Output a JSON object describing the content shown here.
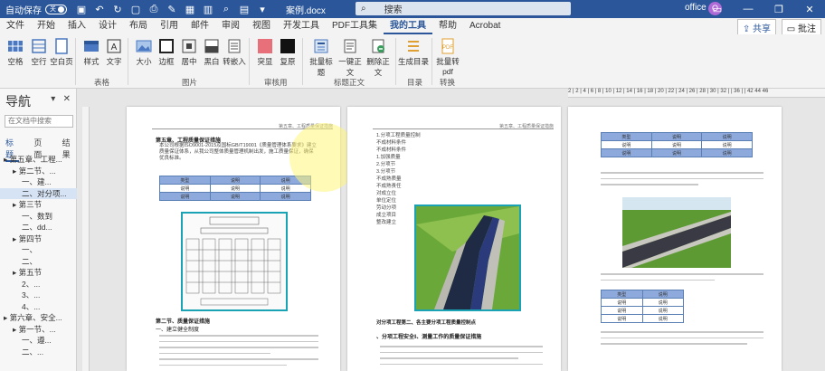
{
  "titlebar": {
    "autosave_label": "自动保存",
    "autosave_state": "关",
    "doc_title": "案例.docx",
    "search_placeholder": "搜索",
    "account": "office",
    "avatar_initial": "O"
  },
  "tabs": [
    "文件",
    "开始",
    "插入",
    "设计",
    "布局",
    "引用",
    "邮件",
    "审阅",
    "视图",
    "开发工具",
    "PDF工具集",
    "我的工具",
    "帮助",
    "Acrobat"
  ],
  "active_tab": "我的工具",
  "share_label": "共享",
  "comment_label": "批注",
  "ribbon": {
    "buttons": [
      {
        "label": "空格",
        "icon": "grid-icon"
      },
      {
        "label": "空行",
        "icon": "rows-icon"
      },
      {
        "label": "空白页",
        "icon": "page-icon"
      },
      {
        "label": "样式",
        "icon": "style-icon"
      },
      {
        "label": "文字",
        "icon": "text-icon"
      },
      {
        "label": "大小",
        "icon": "image-icon"
      },
      {
        "label": "边框",
        "icon": "border-icon"
      },
      {
        "label": "居中",
        "icon": "center-icon"
      },
      {
        "label": "黑白",
        "icon": "bw-icon"
      },
      {
        "label": "转嵌入",
        "icon": "embed-icon"
      },
      {
        "label": "突显",
        "icon": "highlight-icon"
      },
      {
        "label": "复原",
        "icon": "restore-icon"
      },
      {
        "label": "批量标题",
        "icon": "heading-icon"
      },
      {
        "label": "一键正文",
        "icon": "body-text-icon"
      },
      {
        "label": "删除正文",
        "icon": "delete-text-icon"
      },
      {
        "label": "生成目录",
        "icon": "toc-icon"
      },
      {
        "label": "批量转pdf",
        "icon": "pdf-icon"
      }
    ],
    "groups": [
      "表格",
      "图片",
      "审核用",
      "标题正文",
      "目录",
      "转换"
    ]
  },
  "ruler_text": "2 | 2 | 4 | 6 | 8 | 10 | 12 | 14 | 16 | 18 | 20 | 22 | 24 | 26 | 28 | 30 | 32 |  | 36 |  | 42 44 46",
  "nav": {
    "title": "导航",
    "search_placeholder": "在文档中搜索",
    "tabs": [
      "标题",
      "页面",
      "结果"
    ],
    "active_tab": "标题",
    "items": [
      {
        "text": "▸ 第五章、工程...",
        "indent": 0,
        "selected": false
      },
      {
        "text": "▸ 第二节、...",
        "indent": 1,
        "selected": false
      },
      {
        "text": "一、建...",
        "indent": 2,
        "selected": false
      },
      {
        "text": "二、对分项...",
        "indent": 2,
        "selected": true
      },
      {
        "text": "▸ 第三节",
        "indent": 1,
        "selected": false
      },
      {
        "text": "一、数到",
        "indent": 2,
        "selected": false
      },
      {
        "text": "二、dd...",
        "indent": 2,
        "selected": false
      },
      {
        "text": "▸ 第四节",
        "indent": 1,
        "selected": false
      },
      {
        "text": "一、",
        "indent": 2,
        "selected": false
      },
      {
        "text": "二、",
        "indent": 2,
        "selected": false
      },
      {
        "text": "▸ 第五节",
        "indent": 1,
        "selected": false
      },
      {
        "text": "2、...",
        "indent": 2,
        "selected": false
      },
      {
        "text": "3、...",
        "indent": 2,
        "selected": false
      },
      {
        "text": "4、...",
        "indent": 2,
        "selected": false
      },
      {
        "text": "▸ 第六章、安全...",
        "indent": 0,
        "selected": false
      },
      {
        "text": "▸ 第一节、...",
        "indent": 1,
        "selected": false
      },
      {
        "text": "一、遵...",
        "indent": 2,
        "selected": false
      },
      {
        "text": "二、...",
        "indent": 2,
        "selected": false
      }
    ]
  },
  "pages": {
    "header_text": "第五章、工程质量保证措施",
    "p1_heading": "第五章、工程质量保证措施",
    "p1_para": "本公司根据ISO9001-2015及国标GB/T19001《质量管理体系要求》建立质量保证体系，从我公司整体质量管理机制出发，施工质量保证，确保优良标准。",
    "p1_section": "第二节、质量保证措施",
    "p1_sub": "一、建立健全制度",
    "p2_list": [
      "1.分项工程质量控制",
      "不成材料条件",
      "不成材料条件",
      "1.加强质量",
      "2.分项节",
      "3.分项节",
      "不成熟质量",
      "不成熟责任",
      "对成立位",
      "单位定位",
      "劳动分项",
      "成立项目",
      "整改建立"
    ],
    "p2_heading": "对分项工程第二、各主要分项工程质量控制点",
    "p2_sub": "、分项工程安全Ⅰ、测量工作的质量保证措施",
    "table_headers": [
      "类型",
      "说明",
      "说明"
    ],
    "table_cell": "说明",
    "table_row_label": "说明"
  }
}
